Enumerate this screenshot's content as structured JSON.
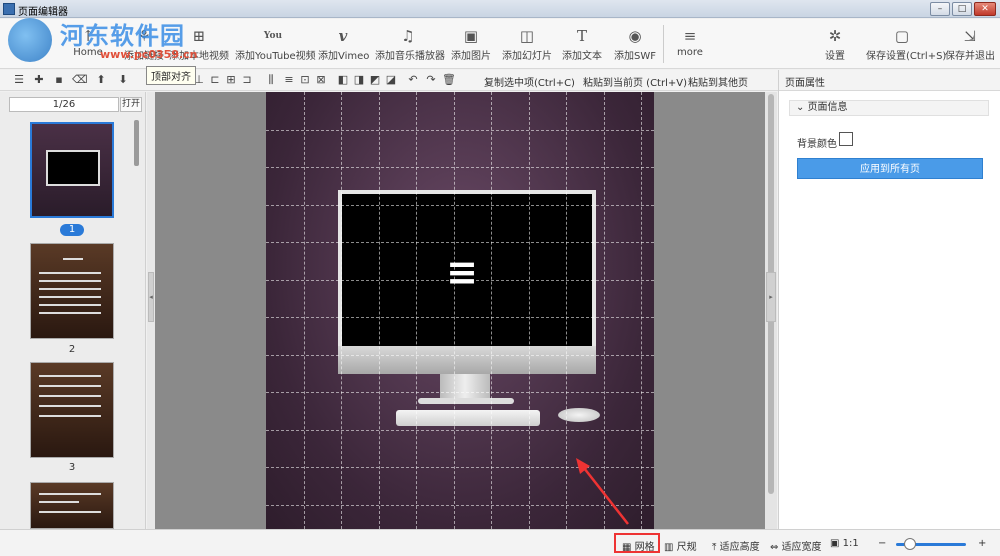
{
  "window": {
    "title": "页面编辑器",
    "minimize": "–",
    "maximize": "□",
    "close": "✕"
  },
  "watermark": {
    "text": "河东软件园",
    "url": "www.pc0359.cn"
  },
  "ribbon": {
    "items": [
      {
        "label": "Home",
        "icon": "↑"
      },
      {
        "label": "添加链接",
        "icon": "⚘"
      },
      {
        "label": "添加本地视频",
        "icon": "⊞"
      },
      {
        "label": "添加YouTube视频",
        "icon": "You"
      },
      {
        "label": "添加Vimeo",
        "icon": "v"
      },
      {
        "label": "添加音乐播放器",
        "icon": "♫"
      },
      {
        "label": "添加图片",
        "icon": "▣"
      },
      {
        "label": "添加幻灯片",
        "icon": "◫"
      },
      {
        "label": "添加文本",
        "icon": "T"
      },
      {
        "label": "添加SWF",
        "icon": "◉"
      },
      {
        "label": "more",
        "icon": "≡"
      },
      {
        "label": "设置",
        "icon": "✲"
      },
      {
        "label": "保存设置(Ctrl+S)",
        "icon": "▢"
      },
      {
        "label": "保存并退出",
        "icon": "⇲"
      }
    ]
  },
  "toolbar": {
    "tooltip": "顶部对齐",
    "copy": "复制选中项(Ctrl+C)",
    "paste_current": "粘贴到当前页 (Ctrl+V)",
    "paste_other": "粘贴到其他页"
  },
  "pages_panel": {
    "counter": "1/26",
    "open": "打开",
    "pages": [
      {
        "num": "1"
      },
      {
        "num": "2"
      },
      {
        "num": "3"
      }
    ]
  },
  "right_panel": {
    "header": "页面属性",
    "section": "页面信息",
    "bg_label": "背景颜色",
    "apply": "应用到所有页"
  },
  "status": {
    "grid": "网格",
    "ruler": "尺规",
    "fit_height": "适应高度",
    "fit_width": "适应宽度",
    "ratio": "1:1",
    "minus": "−",
    "plus": "+"
  },
  "colors": {
    "accent": "#2a7ad8",
    "highlight": "#e33333",
    "apply": "#4a9be8"
  }
}
